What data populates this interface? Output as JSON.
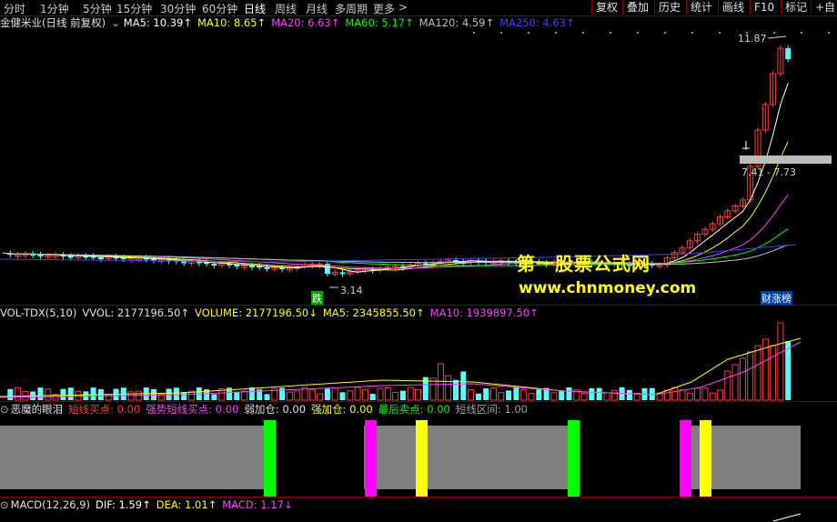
{
  "toolbar": {
    "periods": [
      "分时",
      "1分钟",
      "5分钟",
      "15分钟",
      "30分钟",
      "60分钟",
      "日线",
      "周线",
      "月线",
      "多周期",
      "更多"
    ],
    "active_period": "日线",
    "more_arrow": ">",
    "buttons": [
      "复权",
      "叠加",
      "历史",
      "统计",
      "画线",
      "F10",
      "标记",
      "+自"
    ]
  },
  "main_info": {
    "title": "金健米业(日线 前复权)",
    "dropdown_icon": "chevron-down-icon",
    "ma5": "MA5: 10.39↑",
    "ma10": "MA10: 8.65↑",
    "ma20": "MA20: 6.63↑",
    "ma60": "MA60: 5.17↑",
    "ma120": "MA120: 4.59↑",
    "ma250": "MA250: 4.63↑"
  },
  "price_chart": {
    "high_label": "11.87",
    "low_label": "3.14",
    "range_label": "7.41 - 7.73",
    "badge_down": "跌",
    "badge_right": "财涨榜"
  },
  "watermark": {
    "line1": "第一股票公式网",
    "line2": "www.chnmoney.com"
  },
  "vol_info": {
    "name": "VOL-TDX(5,10)",
    "vvol": "VVOL: 2177196.50↑",
    "volume": "VOLUME: 2177196.50↓",
    "ma5": "MA5: 2345855.50↑",
    "ma10": "MA10: 1939897.50↑"
  },
  "indicator_info": {
    "name": "恶魔的眼泪",
    "item1": "短线买点: 0.00",
    "item2": "强势短线买点: 0.00",
    "item3": "弱加仓: 0.00",
    "item4": "强加仓: 0.00",
    "item5": "最后卖点: 0.00",
    "item6": "短线区间: 1.00"
  },
  "macd_info": {
    "name": "MACD(12,26,9)",
    "dif": "DIF: 1.59↑",
    "dea": "DEA: 1.01↑",
    "macd": "MACD: 1.17↓"
  },
  "colors": {
    "up": "#ff3c3c",
    "down": "#54ffff",
    "ma5": "#ffffff",
    "ma10": "#ffff00",
    "ma20": "#ff40ff",
    "ma60": "#00ff00",
    "ma120": "#c0c0c0",
    "ma250": "#4040ff",
    "band_gray": "#808080",
    "bar_green": "#00ff00",
    "bar_magenta": "#ff00ff",
    "bar_yellow": "#ffff00"
  }
}
